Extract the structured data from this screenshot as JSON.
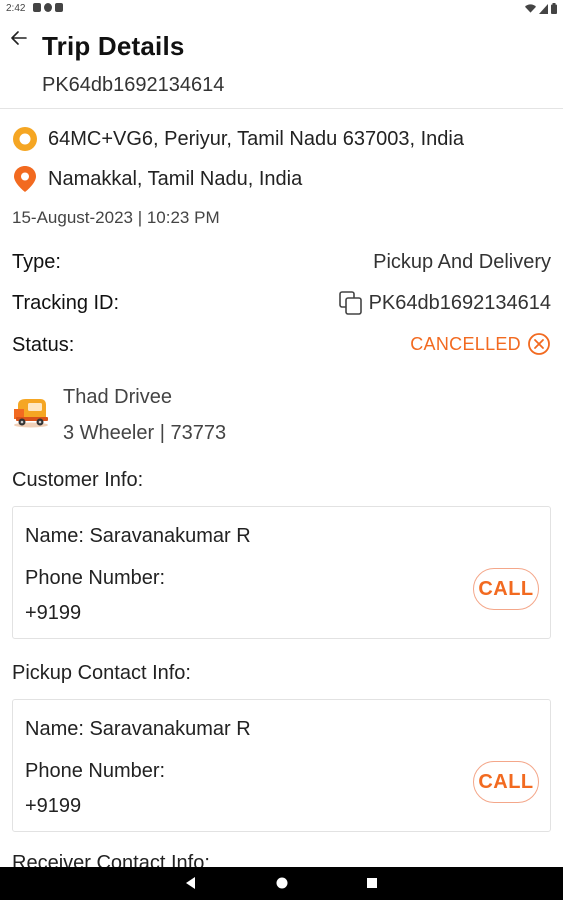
{
  "status_bar": {
    "time": "2:42"
  },
  "header": {
    "title": "Trip Details",
    "trip_id": "PK64db1692134614",
    "back_icon": "arrow-left-icon"
  },
  "locations": {
    "pickup": "64MC+VG6, Periyur, Tamil Nadu 637003, India",
    "drop": "Namakkal, Tamil Nadu, India",
    "pickup_icon": "pickup-pin-icon",
    "drop_icon": "drop-pin-icon"
  },
  "trip_date": "15-August-2023 | 10:23 PM",
  "details": {
    "type_label": "Type:",
    "type_value": "Pickup And Delivery",
    "tracking_label": "Tracking ID:",
    "tracking_value": "PK64db1692134614",
    "status_label": "Status:",
    "status_value": "CANCELLED"
  },
  "driver": {
    "name": "Thad Drivee",
    "vehicle": "3 Wheeler | 73773",
    "icon": "auto-rickshaw-icon"
  },
  "customer_info": {
    "title": "Customer Info:",
    "name": "Name: Saravanakumar R",
    "phone_label": "Phone Number:",
    "phone": "+9199",
    "call_label": "CALL"
  },
  "pickup_contact": {
    "title": "Pickup Contact Info:",
    "name": "Name: Saravanakumar R",
    "phone_label": "Phone Number:",
    "phone": "+9199",
    "call_label": "CALL"
  },
  "receiver_contact": {
    "title": "Receiver Contact Info:"
  },
  "colors": {
    "accent": "#f26a20",
    "pickup_pin": "#f5a623",
    "drop_pin": "#f26a20"
  }
}
